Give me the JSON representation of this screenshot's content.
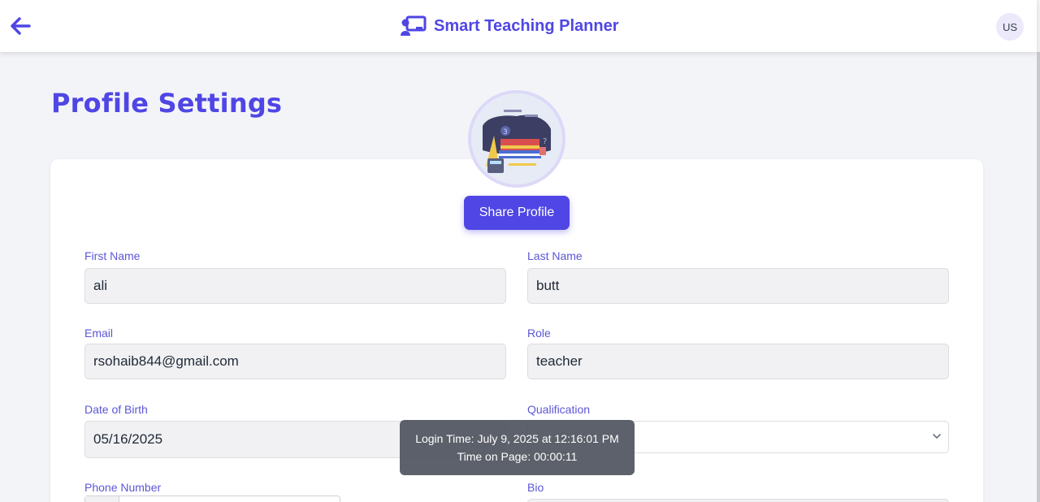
{
  "header": {
    "back_icon": "arrow-left-icon",
    "brand_icon": "teacher-board-icon",
    "title": "Smart Teaching Planner",
    "avatar_initials": "US",
    "accent_color": "#4f46e5"
  },
  "page": {
    "title": "Profile Settings"
  },
  "profile": {
    "share_button_label": "Share Profile"
  },
  "form": {
    "first_name": {
      "label": "First Name",
      "value": "ali"
    },
    "last_name": {
      "label": "Last Name",
      "value": "butt"
    },
    "email": {
      "label": "Email",
      "value": "rsohaib844@gmail.com"
    },
    "role": {
      "label": "Role",
      "value": "teacher"
    },
    "dob": {
      "label": "Date of Birth",
      "value": "05/16/2025"
    },
    "qualification": {
      "label": "Qualification",
      "value": ""
    },
    "phone": {
      "label": "Phone Number",
      "value": ""
    },
    "bio": {
      "label": "Bio",
      "value": ""
    }
  },
  "tooltip": {
    "login_time": "Login Time: July 9, 2025 at 12:16:01 PM",
    "time_on_page": "Time on Page: 00:00:11"
  }
}
